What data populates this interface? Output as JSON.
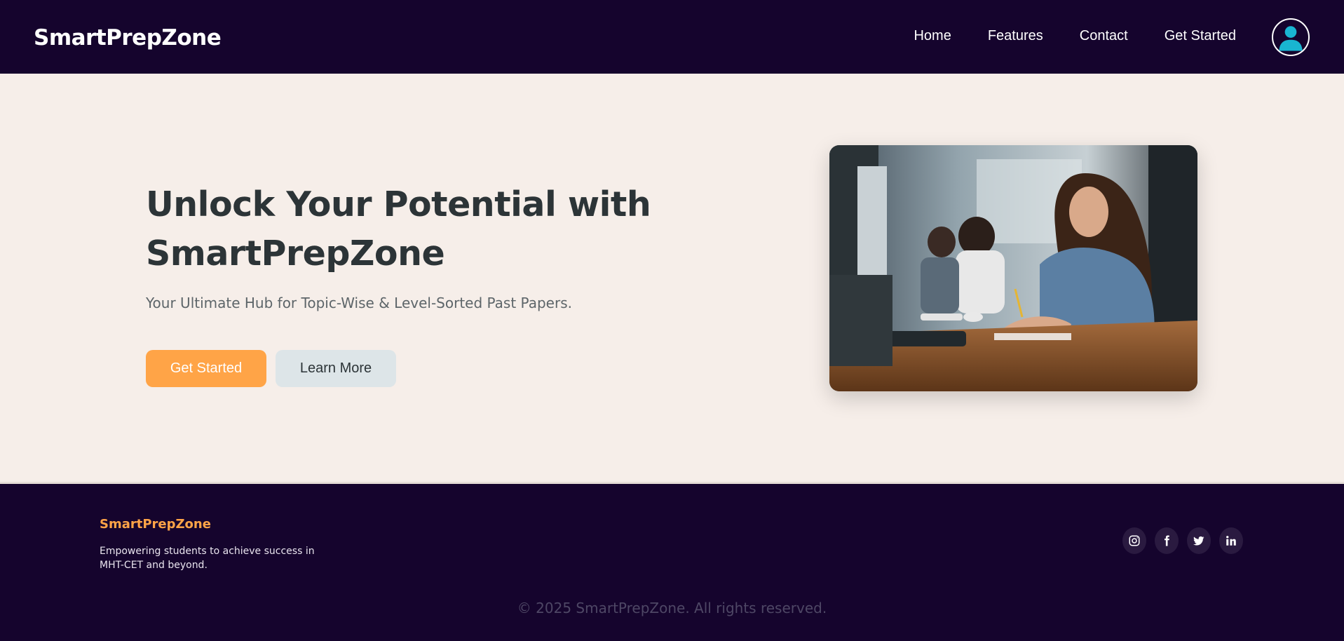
{
  "navbar": {
    "brand": "SmartPrepZone",
    "links": [
      "Home",
      "Features",
      "Contact",
      "Get Started"
    ],
    "avatar_icon": "user-avatar-icon"
  },
  "hero": {
    "title": "Unlock Your Potential with SmartPrepZone",
    "subtitle": "Your Ultimate Hub for Topic-Wise & Level-Sorted Past Papers.",
    "primary_button": "Get Started",
    "secondary_button": "Learn More",
    "image_icon": "students-studying-photo"
  },
  "footer": {
    "brand": "SmartPrepZone",
    "tagline": "Empowering students to achieve success in MHT-CET and beyond.",
    "socials": [
      "instagram-icon",
      "facebook-icon",
      "twitter-icon",
      "linkedin-icon"
    ],
    "copyright": "© 2025 SmartPrepZone. All rights reserved."
  },
  "colors": {
    "nav_bg": "#15042d",
    "hero_bg": "#f6eee9",
    "accent": "#ffa447",
    "heading": "#2c3437"
  }
}
